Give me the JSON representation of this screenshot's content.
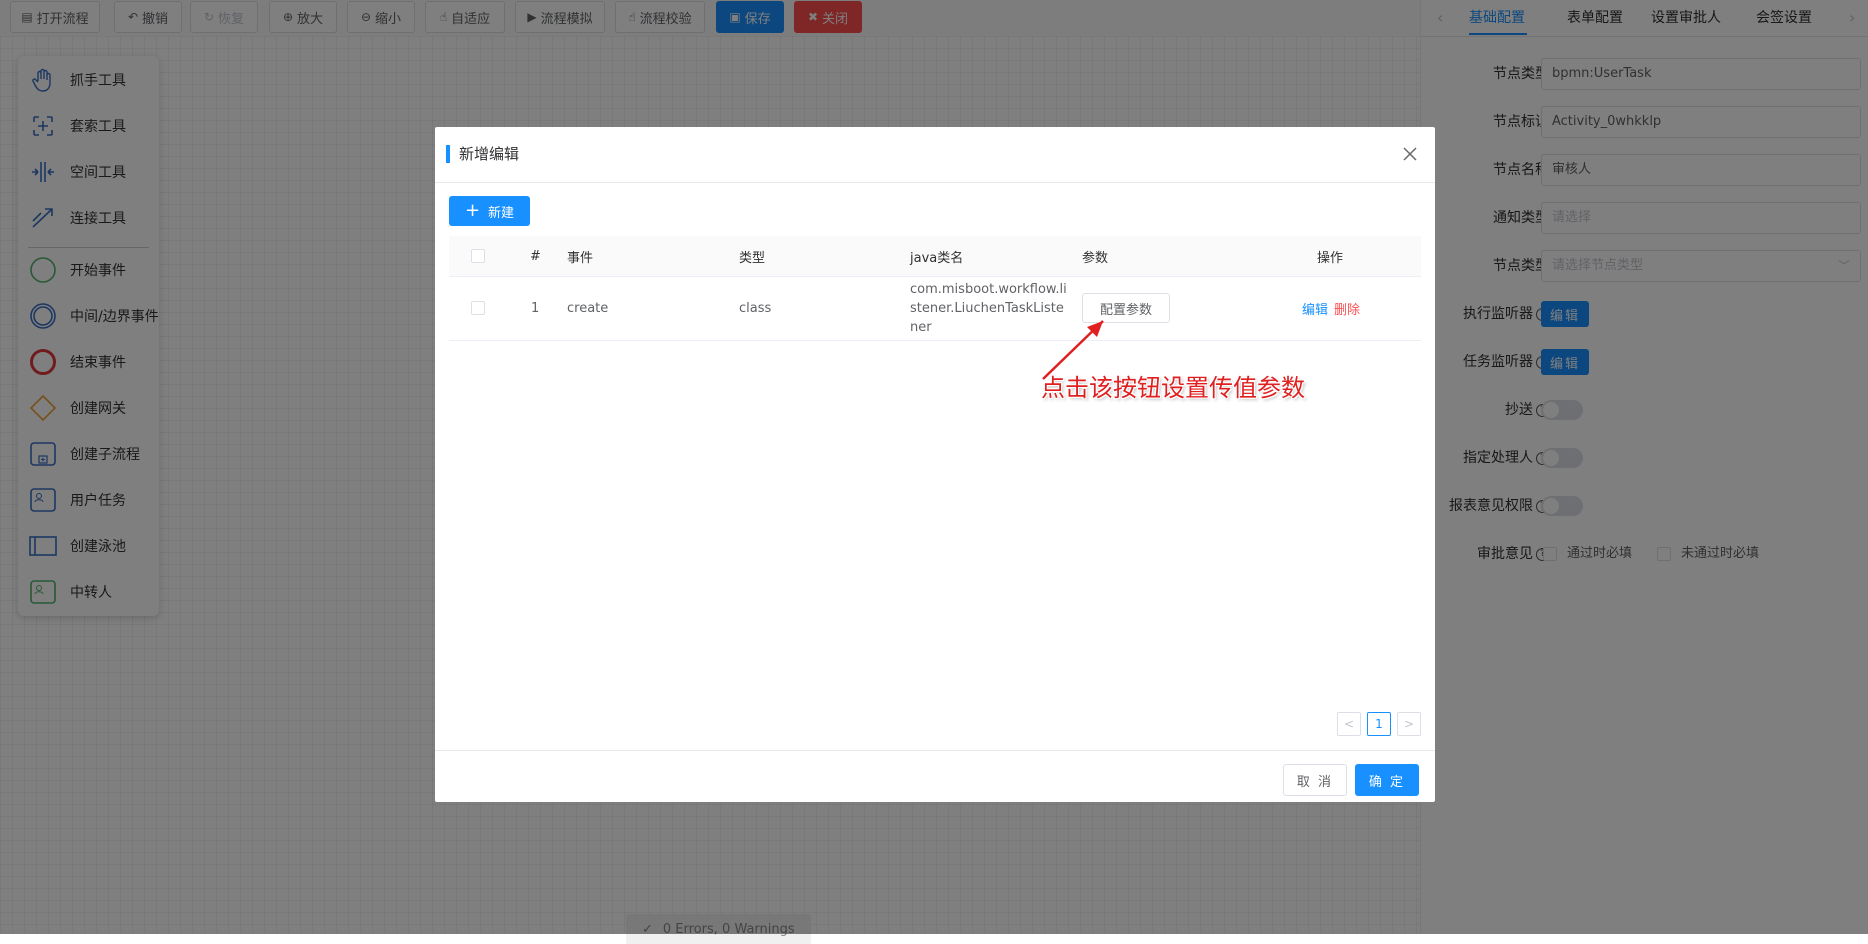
{
  "toolbar": {
    "open_process": "打开流程",
    "undo": "撤销",
    "redo": "恢复",
    "zoom_in": "放大",
    "zoom_out": "缩小",
    "fit": "自适应",
    "simulate": "流程模拟",
    "validate": "流程校验",
    "save": "保存",
    "close": "关闭"
  },
  "palette": {
    "items": [
      {
        "label": "抓手工具",
        "icon": "hand-icon"
      },
      {
        "label": "套索工具",
        "icon": "lasso-icon"
      },
      {
        "label": "空间工具",
        "icon": "space-icon"
      },
      {
        "label": "连接工具",
        "icon": "connect-icon"
      },
      {
        "label": "开始事件",
        "icon": "start-event-icon"
      },
      {
        "label": "中间/边界事件",
        "icon": "intermediate-event-icon"
      },
      {
        "label": "结束事件",
        "icon": "end-event-icon"
      },
      {
        "label": "创建网关",
        "icon": "gateway-icon"
      },
      {
        "label": "创建子流程",
        "icon": "subprocess-icon"
      },
      {
        "label": "用户任务",
        "icon": "user-task-icon"
      },
      {
        "label": "创建泳池",
        "icon": "pool-icon"
      },
      {
        "label": "中转人",
        "icon": "relay-icon"
      }
    ]
  },
  "status_bar": "0 Errors, 0 Warnings",
  "right_panel": {
    "tabs": [
      "基础配置",
      "表单配置",
      "设置审批人",
      "会签设置"
    ],
    "fields": {
      "node_type_label": "节点类型",
      "node_type_value": "bpmn:UserTask",
      "node_id_label": "节点标识",
      "node_id_value": "Activity_0whkklp",
      "node_name_label": "节点名称",
      "node_name_value": "审核人",
      "notify_type_label": "通知类型",
      "notify_type_placeholder": "请选择",
      "node_kind_label": "节点类型",
      "node_kind_placeholder": "请选择节点类型",
      "exec_listener_label": "执行监听器",
      "task_listener_label": "任务监听器",
      "edit_label": "编辑",
      "cc_label": "抄送",
      "assign_label": "指定处理人",
      "report_label": "报表意见权限",
      "approval_label": "审批意见",
      "pass_required": "通过时必填",
      "fail_required": "未通过时必填"
    }
  },
  "dialog": {
    "title": "新增编辑",
    "new_button": "新建",
    "columns": {
      "index": "#",
      "event": "事件",
      "type": "类型",
      "java_class": "java类名",
      "params": "参数",
      "actions": "操作"
    },
    "rows": [
      {
        "index": "1",
        "event": "create",
        "type": "class",
        "java_class": "com.misboot.workflow.listener.LiuchenTaskListener",
        "param_button": "配置参数",
        "edit": "编辑",
        "delete": "删除"
      }
    ],
    "annotation": "点击该按钮设置传值参数",
    "pager": {
      "prev": "<",
      "current": "1",
      "next": ">"
    },
    "cancel": "取 消",
    "confirm": "确 定"
  },
  "colors": {
    "primary": "#1890ff",
    "danger": "#ff4d4f",
    "annotation": "#e02020"
  }
}
